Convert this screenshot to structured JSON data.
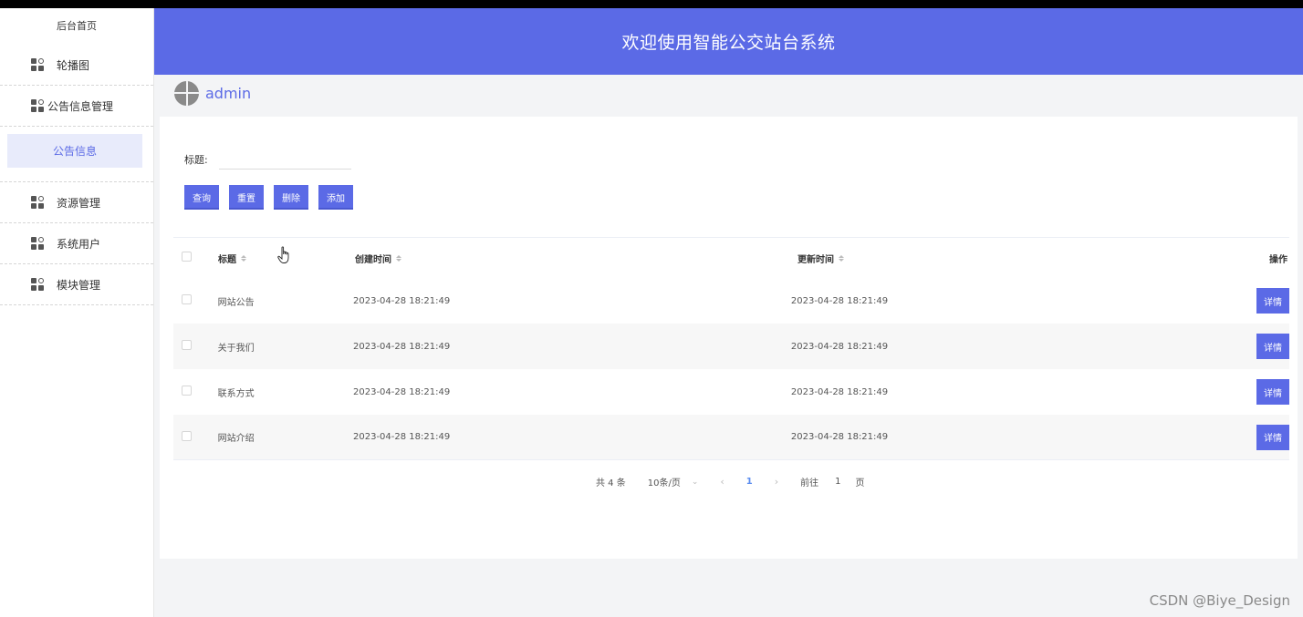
{
  "app": {
    "title": "欢迎使用智能公交站台系统",
    "username": "admin"
  },
  "sidebar": {
    "home": "后台首页",
    "items": [
      {
        "label": "轮播图",
        "icon": "grid-icon"
      },
      {
        "label": "公告信息管理",
        "icon": "grid-icon"
      },
      {
        "label": "公告信息",
        "selected": true
      },
      {
        "label": "资源管理",
        "icon": "grid-icon"
      },
      {
        "label": "系统用户",
        "icon": "grid-icon"
      },
      {
        "label": "模块管理",
        "icon": "grid-icon"
      }
    ]
  },
  "search": {
    "label": "标题:",
    "value": ""
  },
  "toolbar": {
    "query": "查询",
    "reset": "重置",
    "delete": "删除",
    "add": "添加"
  },
  "table": {
    "columns": {
      "title": "标题",
      "created": "创建时间",
      "updated": "更新时间",
      "ops": "操作"
    },
    "rows": [
      {
        "title": "网站公告",
        "created": "2023-04-28 18:21:49",
        "updated": "2023-04-28 18:21:49",
        "action": "详情"
      },
      {
        "title": "关于我们",
        "created": "2023-04-28 18:21:49",
        "updated": "2023-04-28 18:21:49",
        "action": "详情"
      },
      {
        "title": "联系方式",
        "created": "2023-04-28 18:21:49",
        "updated": "2023-04-28 18:21:49",
        "action": "详情"
      },
      {
        "title": "网站介绍",
        "created": "2023-04-28 18:21:49",
        "updated": "2023-04-28 18:21:49",
        "action": "详情"
      }
    ]
  },
  "pagination": {
    "total": "共 4 条",
    "page_size": "10条/页",
    "prev": "‹",
    "current": "1",
    "next": "›",
    "goto_label": "前往",
    "goto_value": "1",
    "page_unit": "页"
  },
  "watermark": "CSDN @Biye_Design",
  "colors": {
    "primary": "#5b6ae6",
    "selected_bg": "#e8ebfb",
    "page_bg": "#f3f4f6"
  }
}
